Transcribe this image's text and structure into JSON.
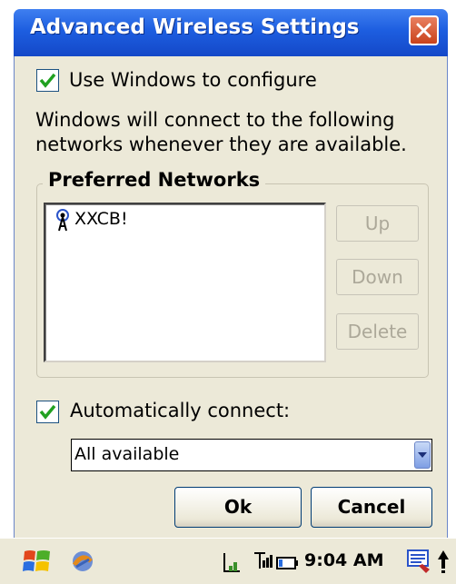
{
  "window": {
    "title": "Advanced Wireless Settings"
  },
  "use_windows": {
    "label": "Use Windows to configure",
    "checked": true
  },
  "description": {
    "line1": "Windows will connect to the following",
    "line2": "networks whenever they are available."
  },
  "preferred": {
    "title": "Preferred Networks",
    "networks": [
      {
        "name": "XXCB!",
        "icon": "wireless-antenna-icon"
      }
    ],
    "buttons": {
      "up": "Up",
      "down": "Down",
      "delete": "Delete"
    }
  },
  "auto_connect": {
    "label": "Automatically connect:",
    "checked": true,
    "selected": "All available"
  },
  "actions": {
    "ok": "Ok",
    "cancel": "Cancel"
  },
  "taskbar": {
    "clock": "9:04 AM"
  },
  "colors": {
    "title_blue": "#1d5ee0",
    "dialog_bg": "#ece9d8",
    "close_red": "#c9421b"
  }
}
